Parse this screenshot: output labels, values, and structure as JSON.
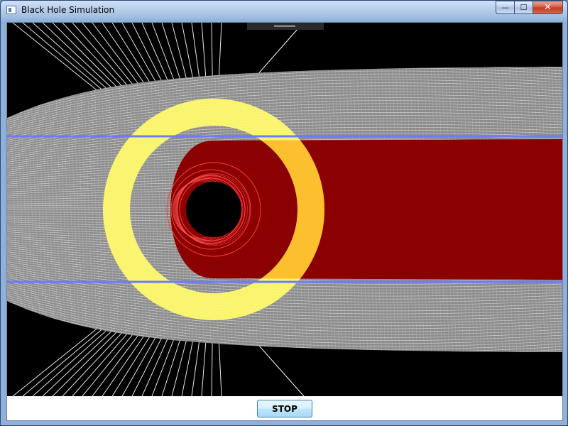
{
  "window": {
    "title": "Black Hole Simulation"
  },
  "controls": {
    "minimize": "—",
    "maximize": "☐",
    "close": "✕"
  },
  "toolbar": {
    "stop_label": "STOP"
  },
  "colors": {
    "canvas_bg": "#000000",
    "ray_color": "#ffffff",
    "ring_color": "#fffa6e",
    "shadow_color": "#8b0000",
    "beam_line_color": "#6e7bff",
    "orbit_color": "#ff3b3b"
  }
}
